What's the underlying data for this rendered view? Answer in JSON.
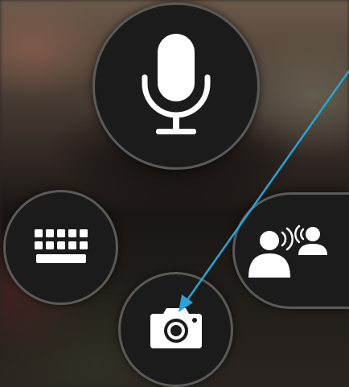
{
  "controls": {
    "microphone": {
      "icon": "microphone-icon"
    },
    "keyboard": {
      "icon": "keyboard-icon"
    },
    "conversation": {
      "icon": "conversation-icon"
    },
    "camera": {
      "icon": "camera-icon"
    }
  },
  "colors": {
    "button_fill": "#1b1b1b",
    "button_border": "#5a5a58",
    "icon": "#ffffff",
    "annotation_arrow": "#2aa3d8"
  }
}
